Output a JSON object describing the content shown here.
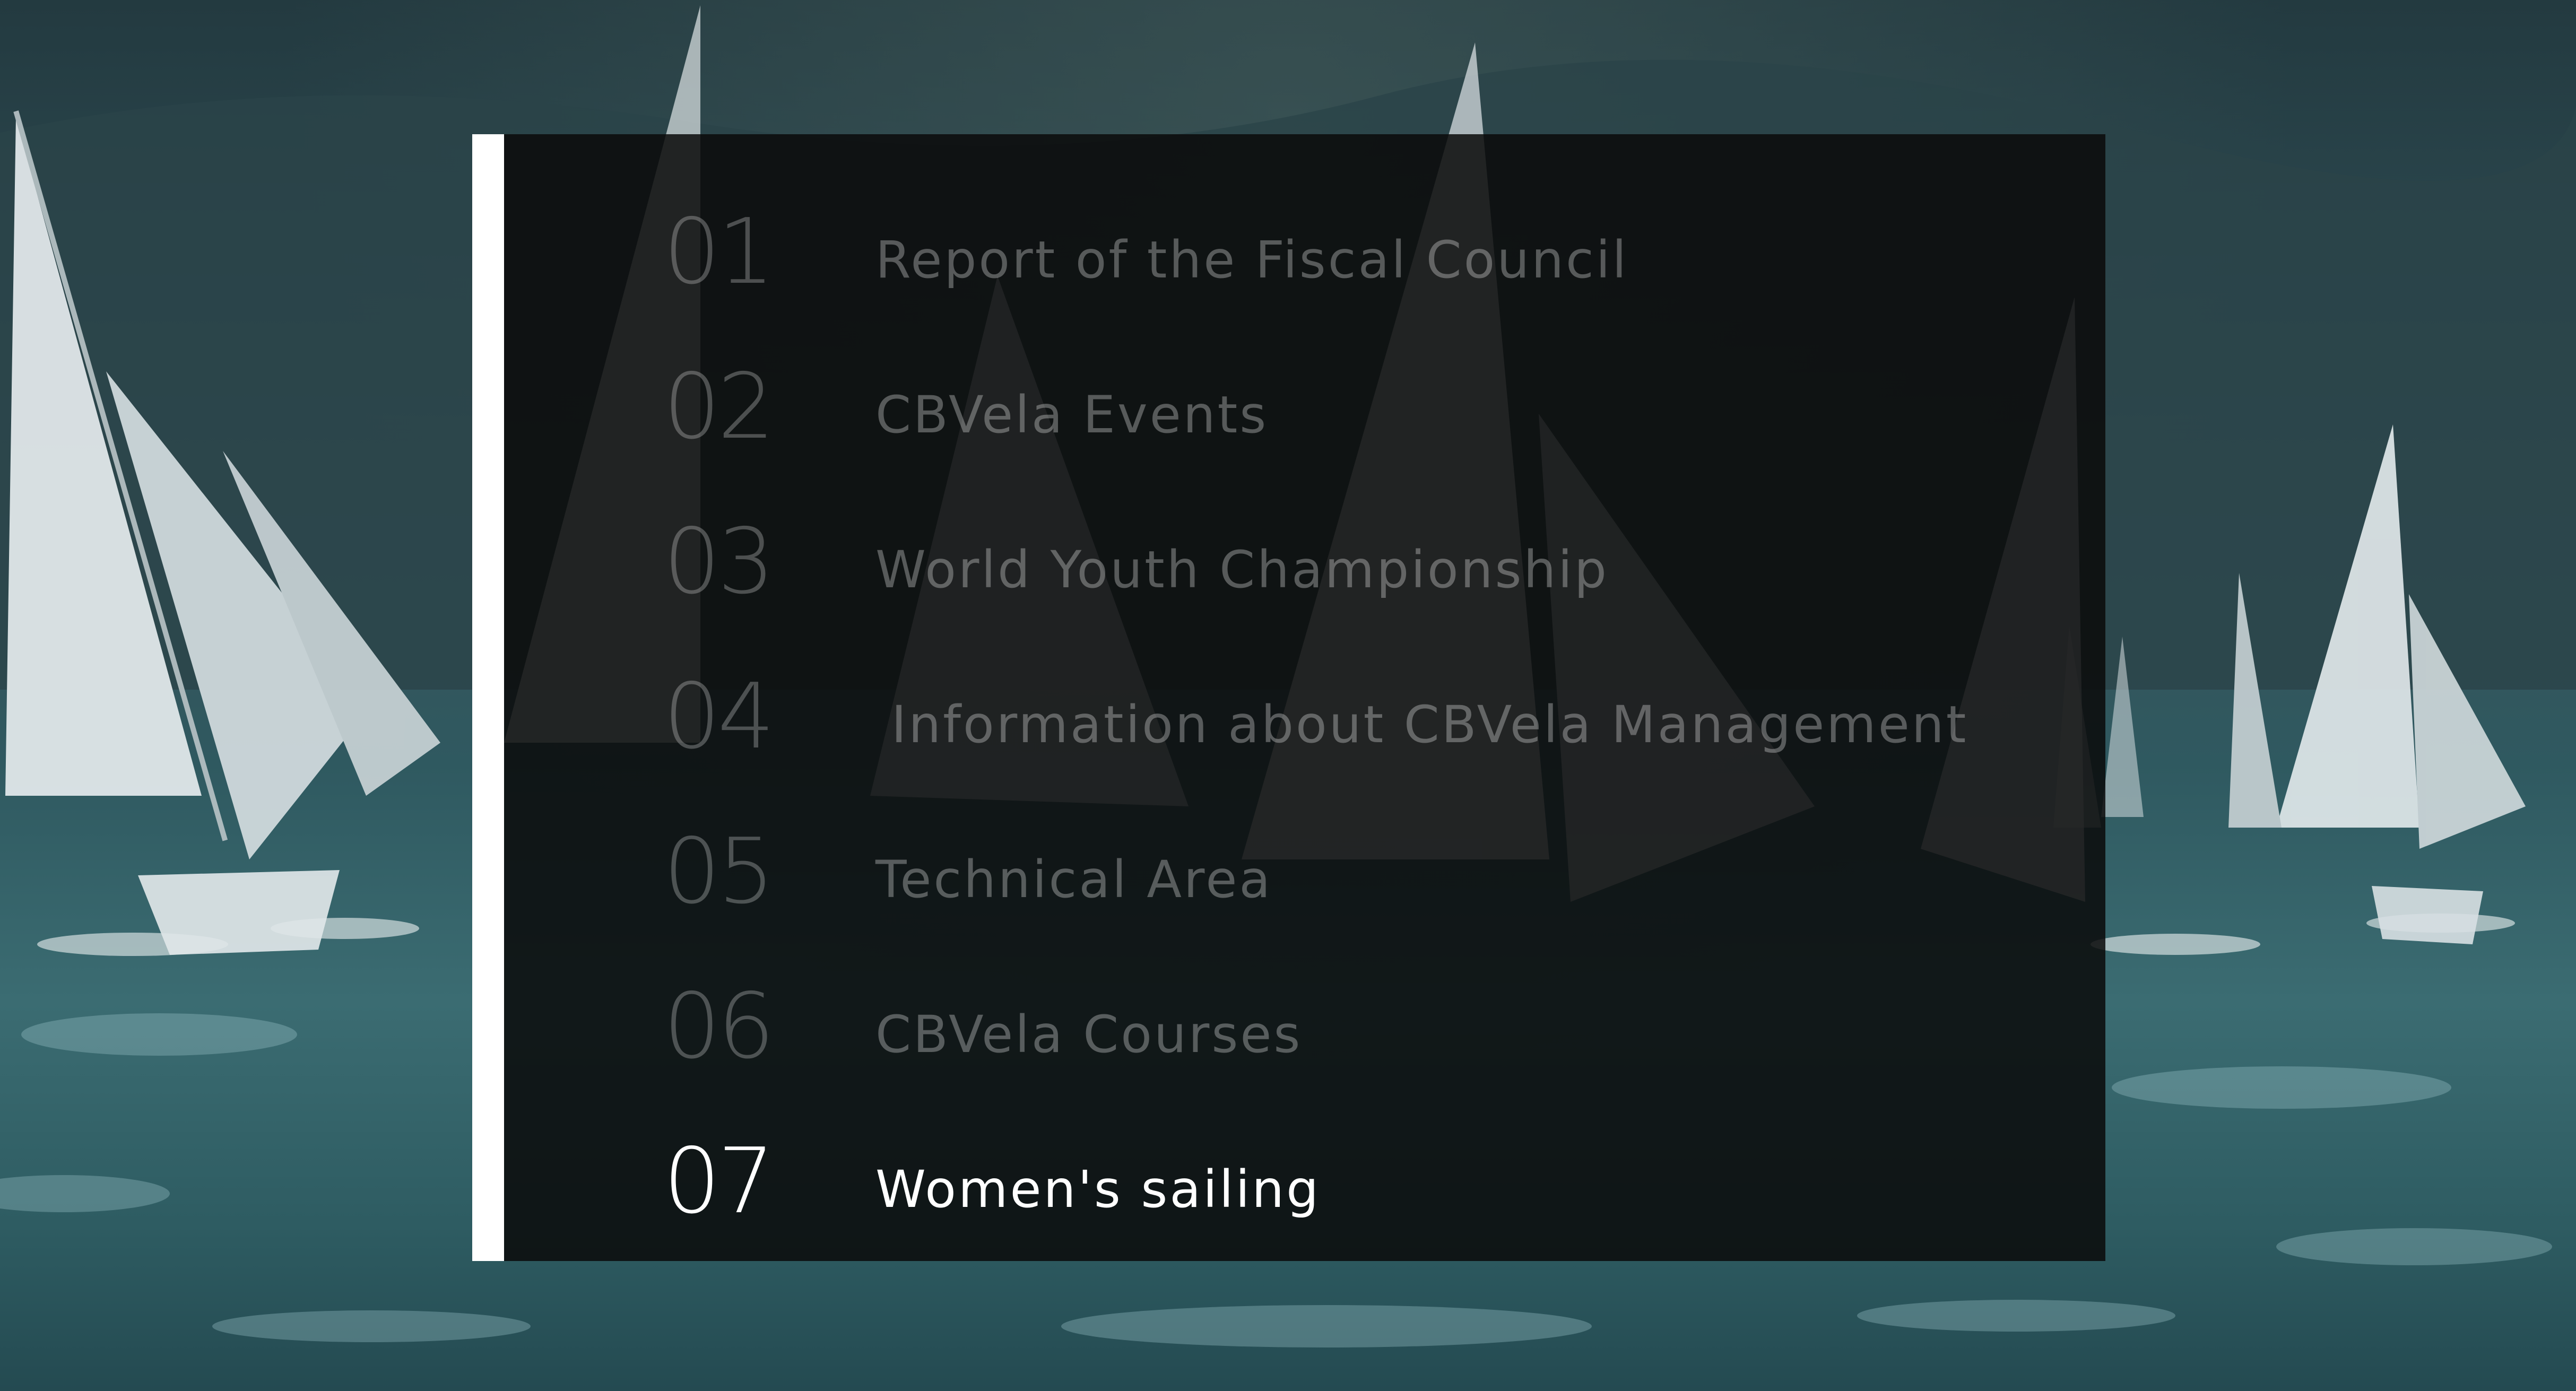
{
  "menu": {
    "items": [
      {
        "number": "01",
        "label": "Report of the Fiscal Council",
        "active": false
      },
      {
        "number": "02",
        "label": "CBVela Events",
        "active": false
      },
      {
        "number": "03",
        "label": "World Youth Championship",
        "active": false
      },
      {
        "number": "04",
        "label": "Information about CBVela Management",
        "active": false
      },
      {
        "number": "05",
        "label": "Technical Area",
        "active": false
      },
      {
        "number": "06",
        "label": "CBVela Courses",
        "active": false
      },
      {
        "number": "07",
        "label": "Women's sailing",
        "active": true
      }
    ]
  },
  "colors": {
    "accent_bar": "#ffffff",
    "panel": "#0a0a0a",
    "inactive_text": "#5a5a5a",
    "active_text": "#ffffff"
  },
  "background": {
    "icon": "sailboat-regatta-photo"
  }
}
